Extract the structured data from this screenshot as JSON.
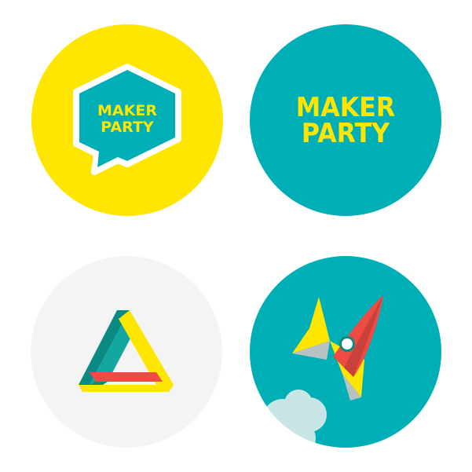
{
  "badges": [
    {
      "id": "maker-party-speech-badge",
      "text_line1": "MAKER",
      "text_line2": "PARTY",
      "bg_color": "#FFE600",
      "shape_color": "#00AEB6",
      "text_color": "#FFE600"
    },
    {
      "id": "maker-party-text-badge",
      "text_line1": "MAKER",
      "text_line2": "PARTY",
      "bg_color": "#00AEB6",
      "text_color": "#FFE600"
    },
    {
      "id": "triangle-badge",
      "bg_color": "#F4F4F4",
      "icon": "impossible-triangle-icon"
    },
    {
      "id": "rocket-badge",
      "bg_color": "#00AEB6",
      "icon": "rocket-icon"
    }
  ],
  "colors": {
    "yellow": "#FFE600",
    "teal": "#00AEB6",
    "dark_teal": "#0A8A82",
    "red": "#EE4B42",
    "dark_red": "#C9413A",
    "light_gray": "#F4F4F4",
    "smoke": "#C9E6E6"
  }
}
